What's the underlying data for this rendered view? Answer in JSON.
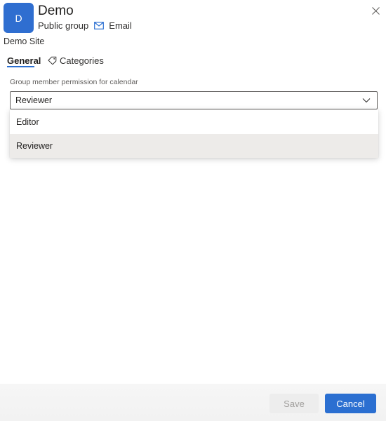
{
  "header": {
    "avatar_letter": "D",
    "title": "Demo",
    "group_type": "Public group",
    "email_label": "Email"
  },
  "site_name": "Demo Site",
  "tabs": [
    {
      "label": "General",
      "selected": true
    },
    {
      "label": "Categories",
      "selected": false
    }
  ],
  "permission_field": {
    "label": "Group member permission for calendar",
    "selected_value": "Reviewer",
    "options": [
      "Editor",
      "Reviewer"
    ]
  },
  "footer": {
    "save_label": "Save",
    "cancel_label": "Cancel"
  },
  "colors": {
    "accent": "#2b6fd1",
    "avatar_bg": "#2f6ed0",
    "highlight_option": "#edebe9"
  },
  "icons": [
    "close-icon",
    "mail-icon",
    "tag-icon",
    "chevron-down-icon"
  ]
}
